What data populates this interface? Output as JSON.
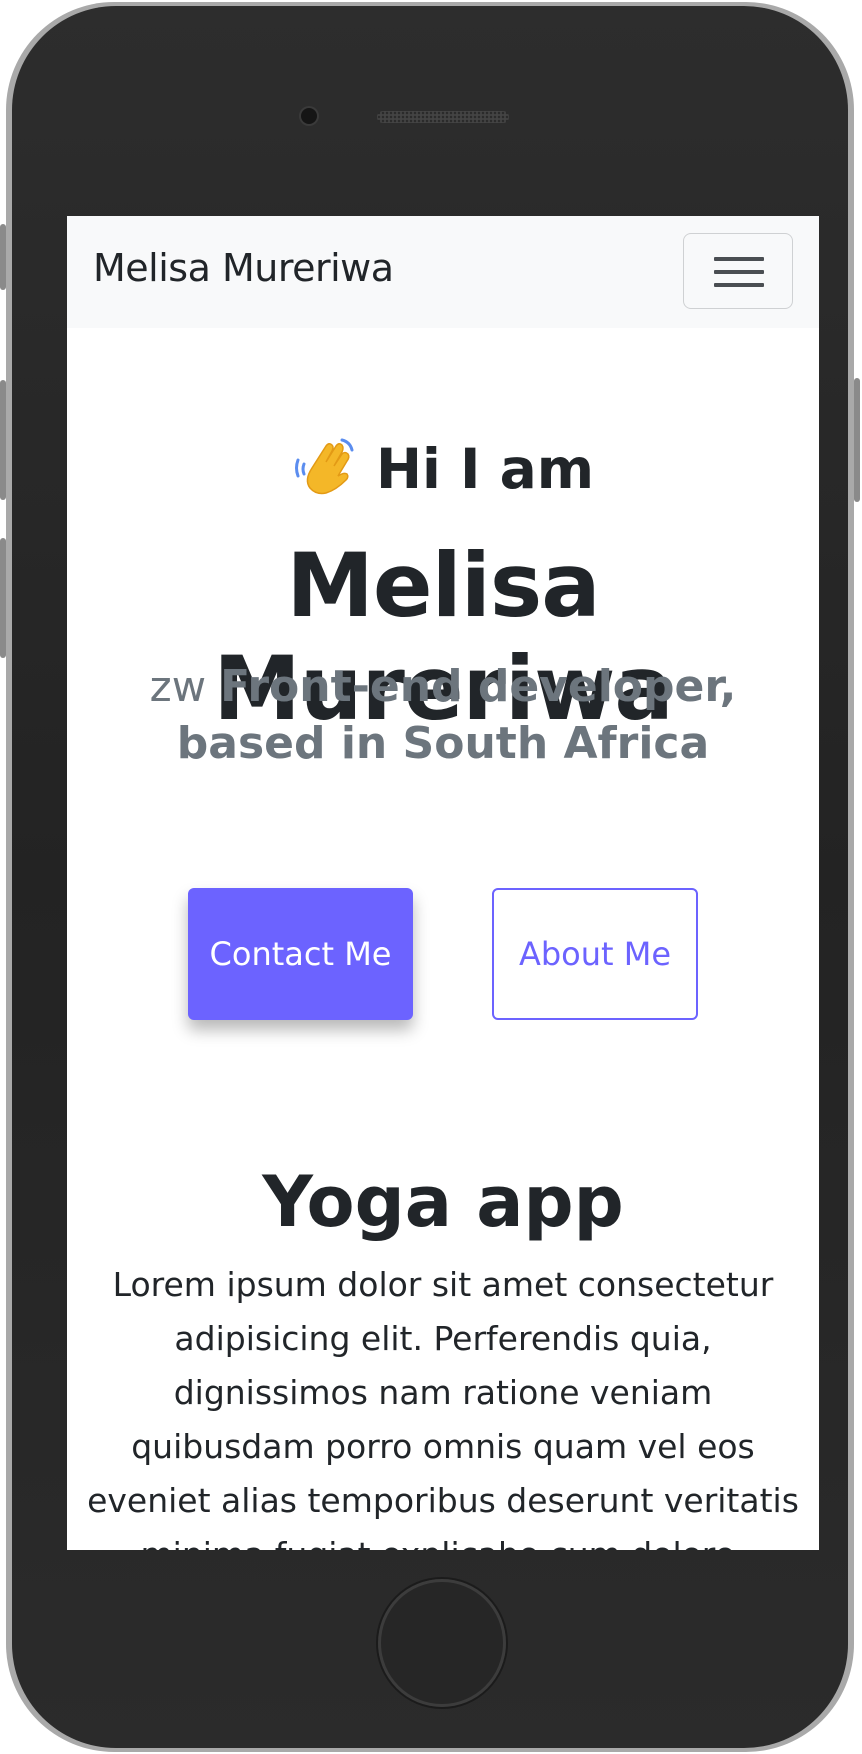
{
  "navbar": {
    "brand": "Melisa Mureriwa",
    "toggler_icon": "hamburger-menu-icon"
  },
  "hero": {
    "wave_icon": "waving-hand-icon",
    "greeting": "Hi I am",
    "name": "Melisa Mureriwa",
    "flag_text": "zw",
    "role": "Front-end developer, based in South Africa"
  },
  "buttons": {
    "contact": "Contact Me",
    "about": "About Me"
  },
  "project": {
    "title": "Yoga app",
    "description": "Lorem ipsum dolor sit amet consectetur adipisicing elit. Perferendis quia, dignissimos nam ratione veniam quibusdam porro omnis quam vel eos eveniet alias temporibus deserunt veritatis minima fugiat explicabo cum dolore."
  },
  "colors": {
    "accent": "#6c63ff",
    "navbar_bg": "#f8f9fa",
    "text_dark": "#212529",
    "text_muted": "#6c757d"
  }
}
